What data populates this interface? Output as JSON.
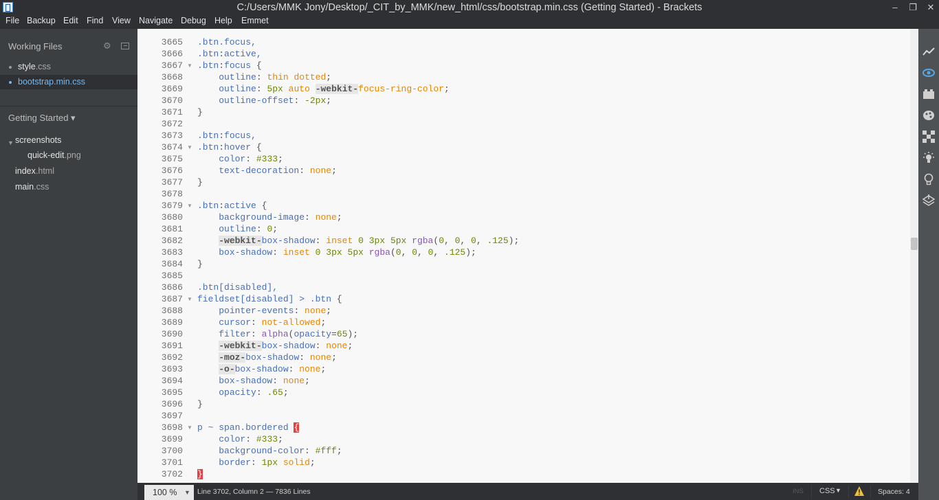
{
  "window": {
    "title": "C:/Users/MMK Jony/Desktop/_CIT_by_MMK/new_html/css/bootstrap.min.css (Getting Started) - Brackets",
    "minimize": "–",
    "maximize": "❐",
    "close": "✕"
  },
  "menu": [
    "File",
    "Backup",
    "Edit",
    "Find",
    "View",
    "Navigate",
    "Debug",
    "Help",
    "Emmet"
  ],
  "sidebar": {
    "working_files_title": "Working Files",
    "working_files": [
      {
        "name": "style",
        "ext": ".css",
        "active": false
      },
      {
        "name": "bootstrap.min",
        "ext": ".css",
        "active": true
      }
    ],
    "project_title": "Getting Started ▾",
    "tree": {
      "folder": "screenshots",
      "folder_child": {
        "name": "quick-edit",
        "ext": ".png"
      },
      "files": [
        {
          "name": "index",
          "ext": ".html"
        },
        {
          "name": "main",
          "ext": ".css"
        }
      ]
    }
  },
  "editor": {
    "lines": [
      {
        "n": "3665",
        "fold": false,
        "text": ".btn.focus,"
      },
      {
        "n": "3666",
        "fold": false,
        "text": ".btn:active,"
      },
      {
        "n": "3667",
        "fold": true,
        "text": ".btn:focus {"
      },
      {
        "n": "3668",
        "fold": false,
        "text": "    outline: thin dotted;"
      },
      {
        "n": "3669",
        "fold": false,
        "text": "    outline: 5px auto -webkit-focus-ring-color;"
      },
      {
        "n": "3670",
        "fold": false,
        "text": "    outline-offset: -2px;"
      },
      {
        "n": "3671",
        "fold": false,
        "text": "}"
      },
      {
        "n": "3672",
        "fold": false,
        "text": ""
      },
      {
        "n": "3673",
        "fold": false,
        "text": ".btn:focus,"
      },
      {
        "n": "3674",
        "fold": true,
        "text": ".btn:hover {"
      },
      {
        "n": "3675",
        "fold": false,
        "text": "    color: #333;"
      },
      {
        "n": "3676",
        "fold": false,
        "text": "    text-decoration: none;"
      },
      {
        "n": "3677",
        "fold": false,
        "text": "}"
      },
      {
        "n": "3678",
        "fold": false,
        "text": ""
      },
      {
        "n": "3679",
        "fold": true,
        "text": ".btn:active {"
      },
      {
        "n": "3680",
        "fold": false,
        "text": "    background-image: none;"
      },
      {
        "n": "3681",
        "fold": false,
        "text": "    outline: 0;"
      },
      {
        "n": "3682",
        "fold": false,
        "text": "    -webkit-box-shadow: inset 0 3px 5px rgba(0, 0, 0, .125);"
      },
      {
        "n": "3683",
        "fold": false,
        "text": "    box-shadow: inset 0 3px 5px rgba(0, 0, 0, .125);"
      },
      {
        "n": "3684",
        "fold": false,
        "text": "}"
      },
      {
        "n": "3685",
        "fold": false,
        "text": ""
      },
      {
        "n": "3686",
        "fold": false,
        "text": ".btn[disabled],"
      },
      {
        "n": "3687",
        "fold": true,
        "text": "fieldset[disabled] > .btn {"
      },
      {
        "n": "3688",
        "fold": false,
        "text": "    pointer-events: none;"
      },
      {
        "n": "3689",
        "fold": false,
        "text": "    cursor: not-allowed;"
      },
      {
        "n": "3690",
        "fold": false,
        "text": "    filter: alpha(opacity=65);"
      },
      {
        "n": "3691",
        "fold": false,
        "text": "    -webkit-box-shadow: none;"
      },
      {
        "n": "3692",
        "fold": false,
        "text": "    -moz-box-shadow: none;"
      },
      {
        "n": "3693",
        "fold": false,
        "text": "    -o-box-shadow: none;"
      },
      {
        "n": "3694",
        "fold": false,
        "text": "    box-shadow: none;"
      },
      {
        "n": "3695",
        "fold": false,
        "text": "    opacity: .65;"
      },
      {
        "n": "3696",
        "fold": false,
        "text": "}"
      },
      {
        "n": "3697",
        "fold": false,
        "text": ""
      },
      {
        "n": "3698",
        "fold": true,
        "text": "p ~ span.bordered {"
      },
      {
        "n": "3699",
        "fold": false,
        "text": "    color: #333;"
      },
      {
        "n": "3700",
        "fold": false,
        "text": "    background-color: #fff;"
      },
      {
        "n": "3701",
        "fold": false,
        "text": "    border: 1px solid;"
      },
      {
        "n": "3702",
        "fold": false,
        "text": "}"
      }
    ]
  },
  "toolbar_icons": [
    "live-preview-icon",
    "eye-icon",
    "extension-manager-icon",
    "theme-icon",
    "checker-icon",
    "lightbulb-icon",
    "bulb-outline-icon",
    "layers-icon"
  ],
  "status": {
    "zoom": "100 %",
    "cursor": "Line 3702, Column 2 — 7836 Lines",
    "ins": "INS",
    "language": "CSS",
    "spaces": "Spaces: 4"
  }
}
